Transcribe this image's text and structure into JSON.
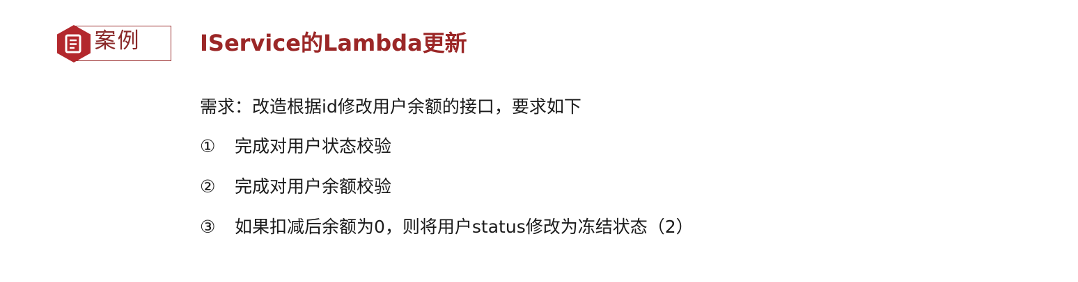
{
  "badge": {
    "label": "案例",
    "icon": "document-icon",
    "color": "#9b2f2f"
  },
  "title": "IService的Lambda更新",
  "requirement": "需求：改造根据id修改用户余额的接口，要求如下",
  "items": [
    {
      "num": "①",
      "text": "完成对用户状态校验"
    },
    {
      "num": "②",
      "text": "完成对用户余额校验"
    },
    {
      "num": "③",
      "text": "如果扣减后余额为0，则将用户status修改为冻结状态（2）"
    }
  ]
}
